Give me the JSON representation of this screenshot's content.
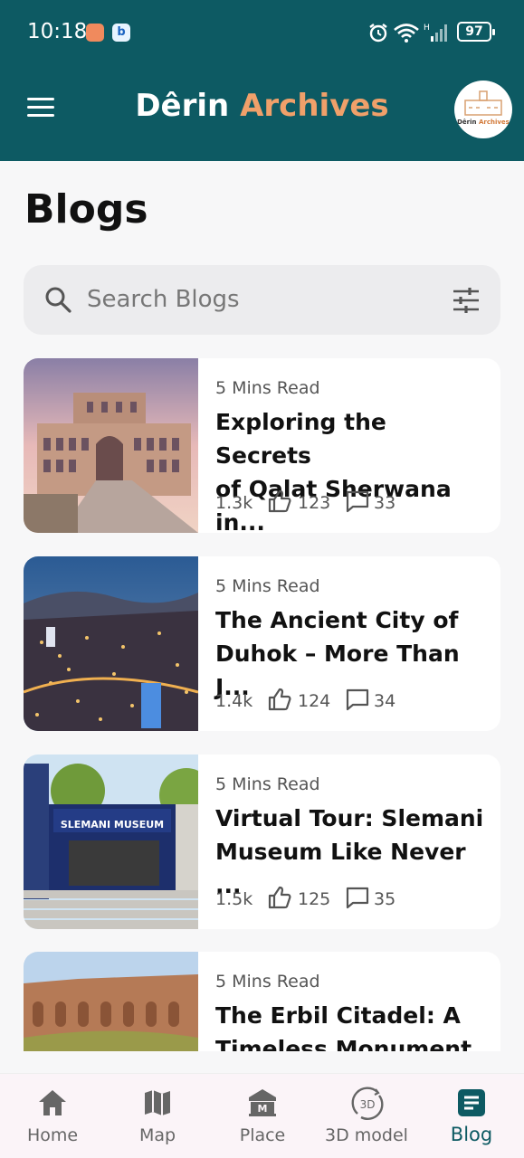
{
  "status_bar": {
    "time": "10:18",
    "battery": "97"
  },
  "header": {
    "title_part1": "Dêrin",
    "title_part2": "Archives",
    "logo_text_part1": "Dêrin",
    "logo_text_part2": "Archives"
  },
  "page": {
    "title": "Blogs"
  },
  "search": {
    "placeholder": "Search Blogs",
    "value": ""
  },
  "blogs": [
    {
      "read_time": "5 Mins Read",
      "title": "Exploring the Secrets\nof Qalat Sherwana in...",
      "views": "1.3k",
      "likes": "123",
      "comments": "33"
    },
    {
      "read_time": "5 Mins Read",
      "title": "The Ancient City of\nDuhok – More Than J...",
      "views": "1.4k",
      "likes": "124",
      "comments": "34"
    },
    {
      "read_time": "5 Mins Read",
      "title": " Virtual Tour: Slemani\nMuseum Like Never ...",
      "views": "1.5k",
      "likes": "125",
      "comments": "35"
    },
    {
      "read_time": "5 Mins Read",
      "title": "The Erbil Citadel: A\nTimeless Monument",
      "views": "",
      "likes": "",
      "comments": ""
    }
  ],
  "museum_sign": "SLEMANI MUSEUM",
  "nav": [
    {
      "label": "Home",
      "icon": "home-icon"
    },
    {
      "label": "Map",
      "icon": "map-icon"
    },
    {
      "label": "Place",
      "icon": "museum-icon"
    },
    {
      "label": "3D model",
      "icon": "3d-rotate-icon"
    },
    {
      "label": "Blog",
      "icon": "blog-icon",
      "active": true
    }
  ],
  "colors": {
    "primary": "#0d5a63",
    "accent": "#f0a06a",
    "background": "#f7f7f8"
  }
}
